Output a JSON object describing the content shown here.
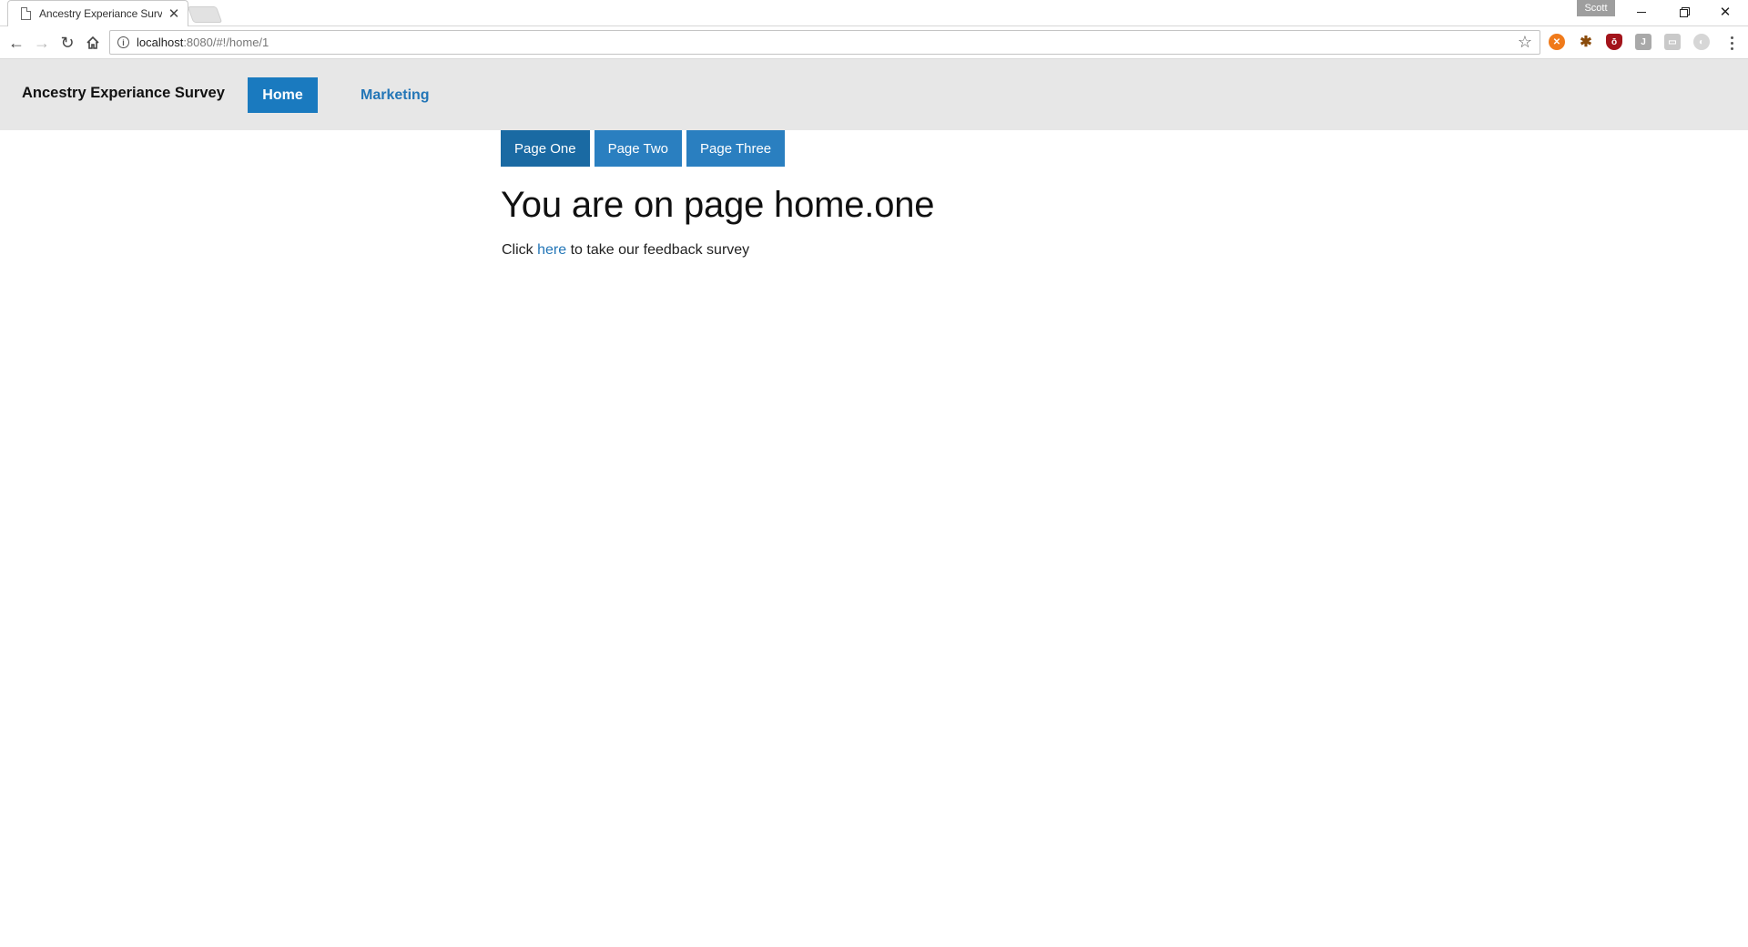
{
  "browser": {
    "tab_title": "Ancestry Experiance Surv",
    "profile_name": "Scott",
    "url_host": "localhost",
    "url_path": ":8080/#!/home/1"
  },
  "app": {
    "brand": "Ancestry Experiance Survey",
    "nav": {
      "home_label": "Home",
      "marketing_label": "Marketing"
    },
    "subnav": [
      {
        "label": "Page One",
        "active": true
      },
      {
        "label": "Page Two",
        "active": false
      },
      {
        "label": "Page Three",
        "active": false
      }
    ],
    "heading": "You are on page home.one",
    "body_prefix": "Click",
    "body_link": "here",
    "body_suffix": "to take our feedback survey"
  },
  "colors": {
    "primary": "#1a7abf",
    "primary_active": "#1a6aa3",
    "navbar_bg": "#e7e7e7",
    "link": "#2376b7"
  },
  "icons": {
    "back": "arrow-left-icon",
    "forward": "arrow-right-icon",
    "reload": "reload-icon",
    "home": "home-icon",
    "info": "info-icon",
    "bookmark": "star-icon",
    "menu": "kebab-menu-icon"
  }
}
